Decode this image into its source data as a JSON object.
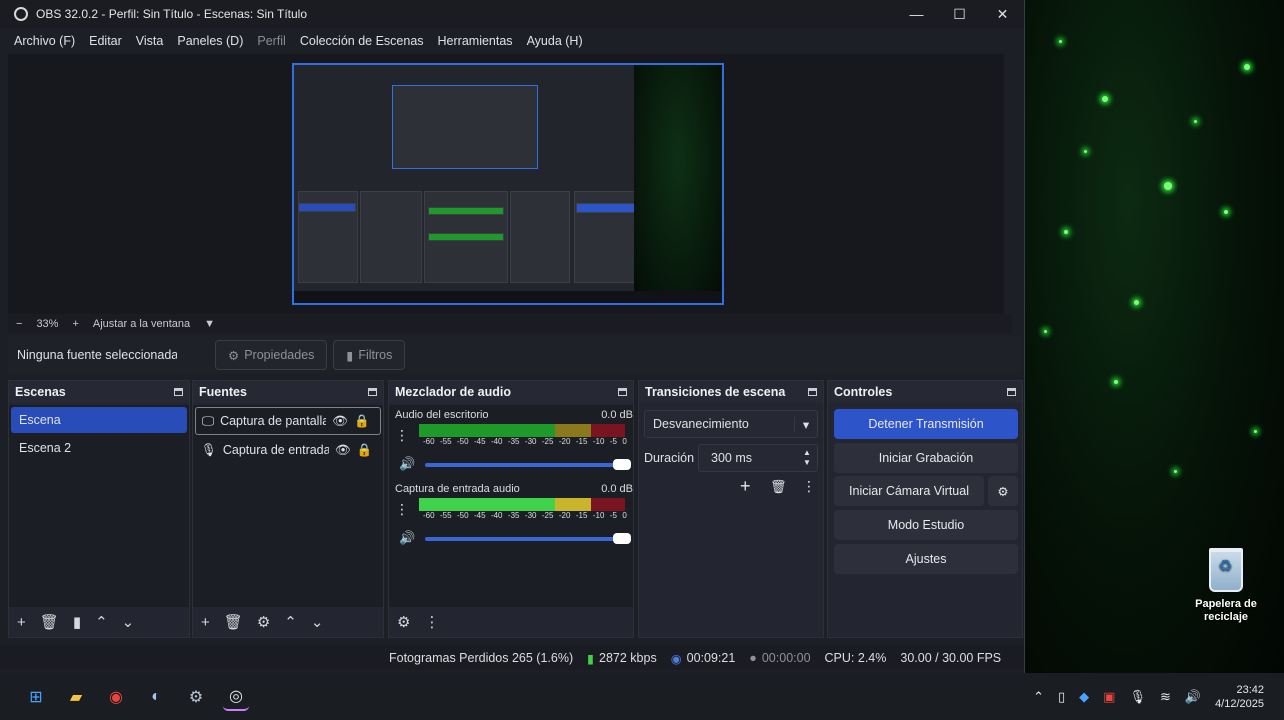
{
  "window": {
    "title": "OBS 32.0.2 - Perfil: Sin Título - Escenas: Sin Título",
    "controls": {
      "minimize": "—",
      "maximize": "☐",
      "close": "✕"
    }
  },
  "menu": {
    "items": [
      "Archivo (F)",
      "Editar",
      "Vista",
      "Paneles (D)",
      "Perfil",
      "Colección de Escenas",
      "Herramientas",
      "Ayuda (H)"
    ]
  },
  "zoom": {
    "minus": "−",
    "value": "33%",
    "plus": "+",
    "fit": "Ajustar a la ventana",
    "arrow": "▼"
  },
  "source_bar": {
    "no_source": "Ninguna fuente seleccionada",
    "properties": "Propiedades",
    "filters": "Filtros"
  },
  "docks": {
    "scenes": {
      "title": "Escenas",
      "items": [
        {
          "label": "Escena",
          "selected": true
        },
        {
          "label": "Escena 2",
          "selected": false
        }
      ]
    },
    "sources": {
      "title": "Fuentes",
      "items": [
        {
          "label": "Captura de pantalla",
          "icon": "monitor-icon",
          "selected": true
        },
        {
          "label": "Captura de entrada",
          "icon": "microphone-icon",
          "selected": false
        }
      ]
    },
    "mixer": {
      "title": "Mezclador de audio",
      "scale": [
        "-60",
        "-55",
        "-50",
        "-45",
        "-40",
        "-35",
        "-30",
        "-25",
        "-20",
        "-15",
        "-10",
        "-5",
        "0"
      ],
      "channels": [
        {
          "name": "Audio del escritorio",
          "db": "0.0 dB",
          "level": 0.0
        },
        {
          "name": "Captura de entrada audio",
          "db": "0.0 dB",
          "level": 0.74
        }
      ]
    },
    "transitions": {
      "title": "Transiciones de escena",
      "selected": "Desvanecimiento",
      "duration_label": "Duración",
      "duration_value": "300 ms"
    },
    "controls": {
      "title": "Controles",
      "buttons": [
        "Detener Transmisión",
        "Iniciar Grabación",
        "Iniciar Cámara Virtual",
        "Modo Estudio",
        "Ajustes"
      ]
    }
  },
  "status": {
    "dropped": "Fotogramas Perdidos 265 (1.6%)",
    "bitrate": "2872 kbps",
    "stream_time": "00:09:21",
    "record_time": "00:00:00",
    "cpu": "CPU: 2.4%",
    "fps": "30.00 / 30.00 FPS"
  },
  "desktop": {
    "recycle_bin": "Papelera de reciclaje"
  },
  "taskbar": {
    "time": "23:42",
    "date": "4/12/2025"
  },
  "colors": {
    "accent": "#2e54c9",
    "selected": "#284cb8",
    "meter_green": "#1e9a2a",
    "meter_red": "#7a1420"
  }
}
